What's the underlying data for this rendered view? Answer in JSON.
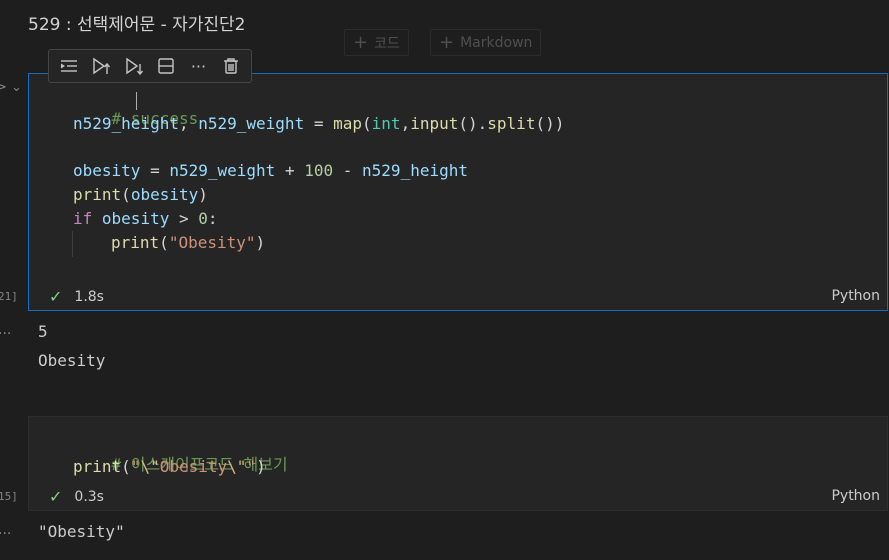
{
  "markdown_heading": "529 : 선택제어문 - 자가진단2",
  "add_cell": {
    "code_label": "코드",
    "markdown_label": "Markdown"
  },
  "cell_toolbar": {
    "icons": [
      "run-by-line-icon",
      "execute-above-icon",
      "execute-below-icon",
      "split-cell-icon",
      "more-actions-icon",
      "delete-icon"
    ],
    "more_label": "···"
  },
  "cell1": {
    "exec_count": "21]",
    "code": {
      "l1_comment": "# success",
      "l2_a": "n529_height",
      "l2_b": ", ",
      "l2_c": "n529_weight",
      "l2_d": " = ",
      "l2_e": "map",
      "l2_f": "(",
      "l2_g": "int",
      "l2_h": ",",
      "l2_i": "input",
      "l2_j": "().",
      "l2_k": "split",
      "l2_l": "())",
      "l4_a": "obesity",
      "l4_b": " = ",
      "l4_c": "n529_weight",
      "l4_d": " + ",
      "l4_e": "100",
      "l4_f": " - ",
      "l4_g": "n529_height",
      "l5_a": "print",
      "l5_b": "(",
      "l5_c": "obesity",
      "l5_d": ")",
      "l6_a": "if",
      "l6_b": " ",
      "l6_c": "obesity",
      "l6_d": " > ",
      "l6_e": "0",
      "l6_f": ":",
      "l7_a": "print",
      "l7_b": "(",
      "l7_c": "\"Obesity\"",
      "l7_d": ")"
    },
    "status": {
      "duration": "1.8s"
    },
    "language": "Python",
    "output_dots": "...",
    "output_lines": [
      "5",
      "Obesity"
    ]
  },
  "cell2": {
    "exec_count": "15]",
    "code": {
      "l1_comment": "# 이스케이프코드 해보기",
      "l2_a": "print",
      "l2_b": "(",
      "l2_c": "\"",
      "l2_d": "\\\"",
      "l2_e": "Obesity",
      "l2_f": "\\\"",
      "l2_g": "\"",
      "l2_h": ")"
    },
    "status": {
      "duration": "0.3s"
    },
    "language": "Python",
    "output_dots": "...",
    "output": "\"Obesity\""
  },
  "colors": {
    "focus_border": "#0f6fbf",
    "success_check": "#89d185",
    "background": "#1e1e1e",
    "cell_background": "#252526"
  }
}
